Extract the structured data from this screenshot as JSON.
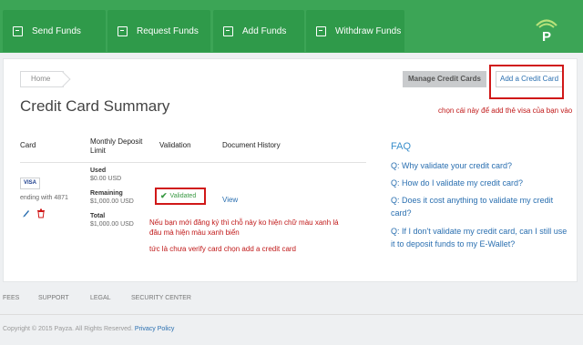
{
  "nav": {
    "items": [
      {
        "label": "Send Funds",
        "icon": "send-funds-icon"
      },
      {
        "label": "Request Funds",
        "icon": "request-funds-icon"
      },
      {
        "label": "Add Funds",
        "icon": "add-funds-icon"
      },
      {
        "label": "Withdraw Funds",
        "icon": "withdraw-funds-icon"
      }
    ],
    "brand_color": "#3ca556"
  },
  "breadcrumb": "Home",
  "page_title": "Credit Card Summary",
  "buttons": {
    "manage": "Manage Credit Cards",
    "add": "Add a Credit Card"
  },
  "annotations": {
    "add_note": "chọn cái này để add thẻ visa của bạn vào",
    "validated_note": "Nếu bạn mới đăng ký thì chỗ này ko hiện chữ màu xanh lá đâu mà hiện màu xanh biển",
    "verify_note": "tức là chưa verify card chọn add a credit card"
  },
  "table": {
    "headers": {
      "card": "Card",
      "limit": "Monthly Deposit Limit",
      "validation": "Validation",
      "history": "Document History"
    },
    "row": {
      "card_brand": "VISA",
      "card_ending": "ending with 4871",
      "used_label": "Used",
      "used_value": "$0.00 USD",
      "remaining_label": "Remaining",
      "remaining_value": "$1,000.00 USD",
      "total_label": "Total",
      "total_value": "$1,000.00 USD",
      "validation_status": "Validated",
      "history_link": "View"
    }
  },
  "faq": {
    "title": "FAQ",
    "questions": [
      "Q: Why validate your credit card?",
      "Q: How do I validate my credit card?",
      "Q: Does it cost anything to validate my credit card?",
      "Q: If I don't validate my credit card, can I still use it to deposit funds to my E-Wallet?"
    ]
  },
  "footer": {
    "links": [
      "FEES",
      "SUPPORT",
      "LEGAL",
      "SECURITY CENTER"
    ],
    "copyright": "Copyright © 2015 Payza. All Rights Reserved.",
    "privacy": "Privacy Policy"
  }
}
